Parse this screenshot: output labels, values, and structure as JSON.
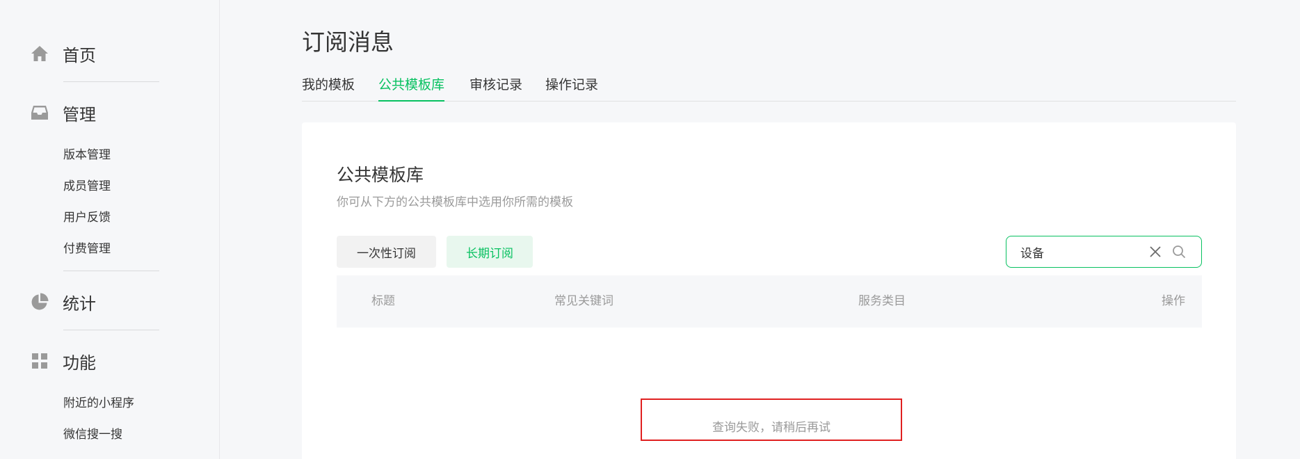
{
  "sidebar": {
    "home": {
      "label": "首页",
      "icon": "home-icon"
    },
    "manage": {
      "label": "管理",
      "icon": "inbox-icon",
      "items": [
        "版本管理",
        "成员管理",
        "用户反馈",
        "付费管理"
      ]
    },
    "stats": {
      "label": "统计",
      "icon": "pie-chart-icon"
    },
    "features": {
      "label": "功能",
      "icon": "grid-icon",
      "items": [
        "附近的小程序",
        "微信搜一搜"
      ]
    }
  },
  "main": {
    "title": "订阅消息",
    "tabs": [
      "我的模板",
      "公共模板库",
      "审核记录",
      "操作记录"
    ],
    "active_tab": "公共模板库",
    "card": {
      "title": "公共模板库",
      "description": "你可从下方的公共模板库中选用你所需的模板",
      "type_buttons": [
        "一次性订阅",
        "长期订阅"
      ],
      "active_type": "长期订阅",
      "search": {
        "value": "设备",
        "icons": [
          "close-icon",
          "search-icon"
        ]
      },
      "table_headers": [
        "标题",
        "常见关键词",
        "服务类目",
        "操作"
      ],
      "error_message": "查询失败，请稍后再试"
    }
  },
  "colors": {
    "accent": "#07c160",
    "accent_bg": "#e8f7ee",
    "error_border": "#e02020",
    "muted_text": "#9a9a9a"
  }
}
